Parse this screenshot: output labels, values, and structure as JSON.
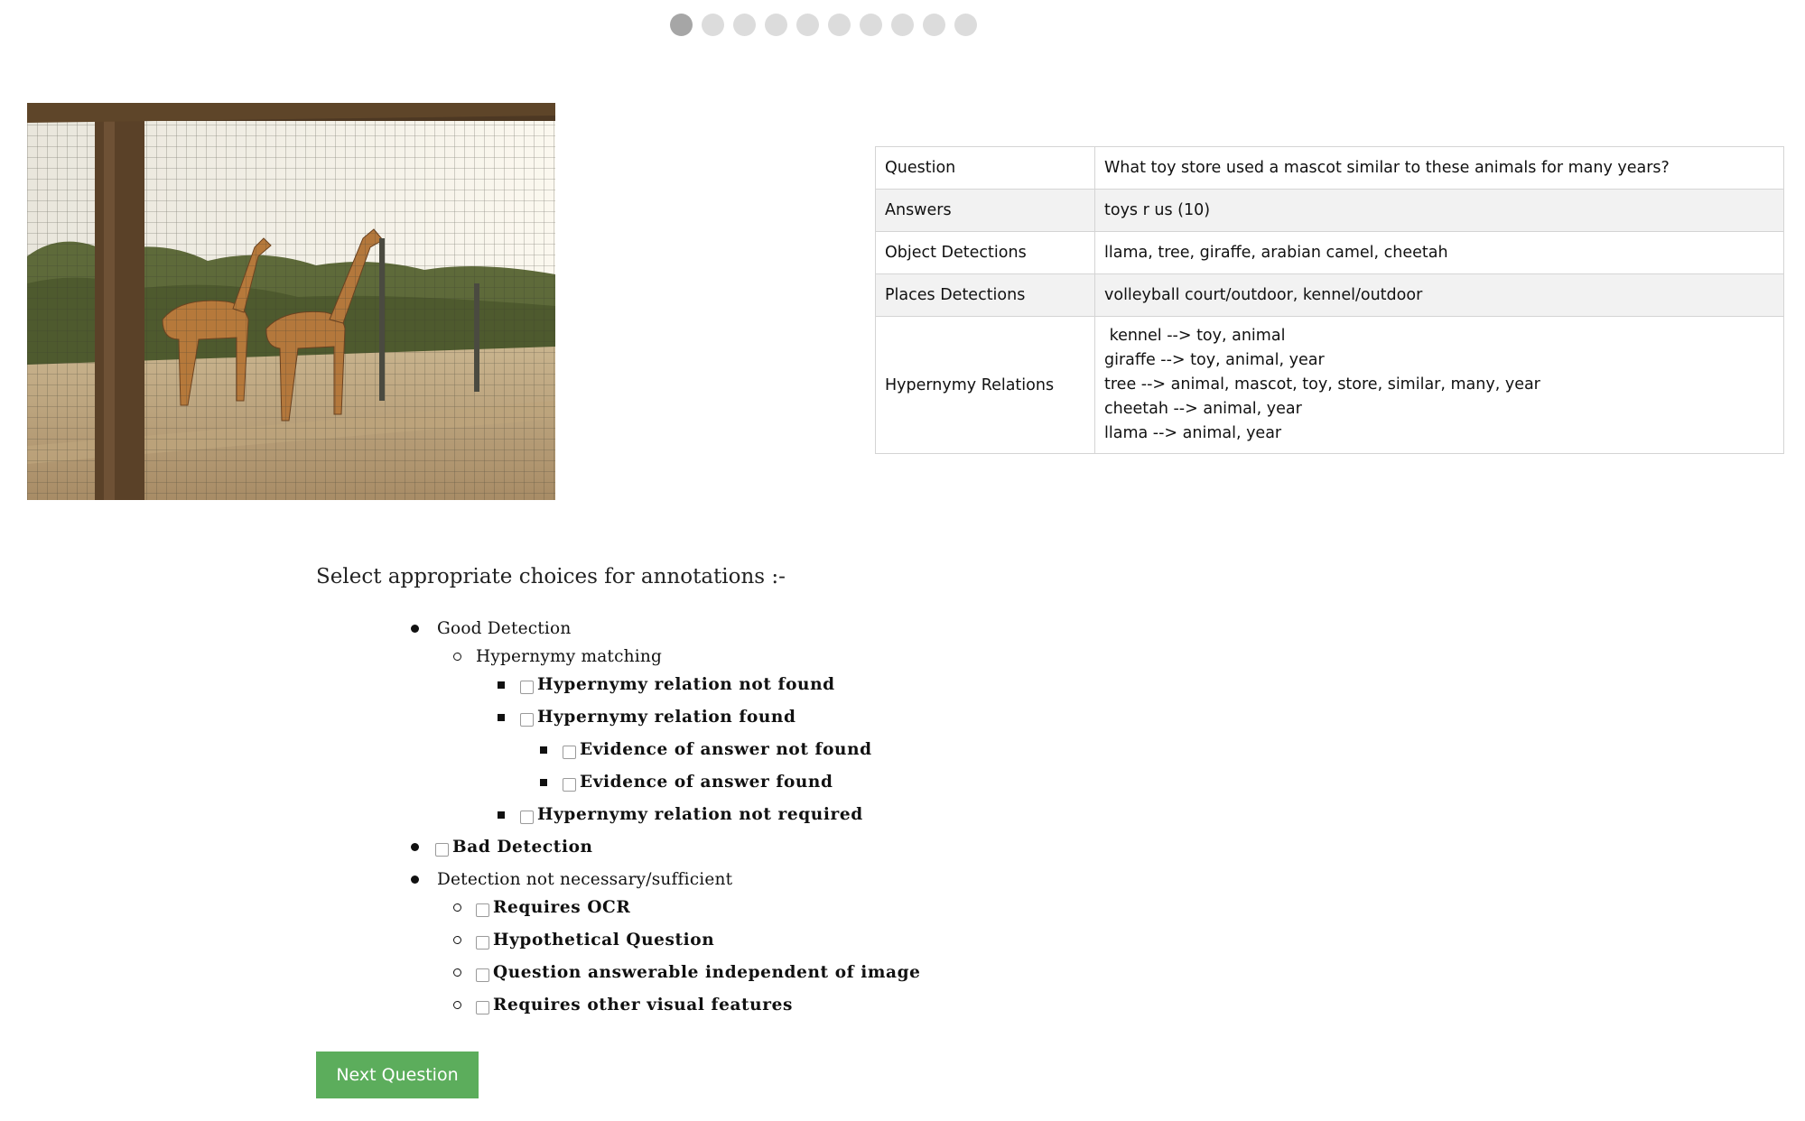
{
  "progress": {
    "total": 10,
    "current": 1
  },
  "image": {
    "alt": "giraffes"
  },
  "info_table": {
    "question_label": "Question",
    "question_value": "What toy store used a mascot similar to these animals for many years?",
    "answers_label": "Answers",
    "answers_value": "toys r us (10)",
    "objects_label": "Object Detections",
    "objects_value": "llama, tree, giraffe, arabian camel, cheetah",
    "places_label": "Places Detections",
    "places_value": "volleyball court/outdoor, kennel/outdoor",
    "hypernymy_label": "Hypernymy Relations",
    "hypernymy_lines": [
      " kennel --> toy, animal",
      "giraffe --> toy, animal, year",
      "tree --> animal, mascot, toy, store, similar, many, year",
      "cheetah --> animal, year",
      "llama --> animal, year"
    ]
  },
  "annotations": {
    "prompt": "Select appropriate choices for annotations :-",
    "good_detection": "Good Detection",
    "hypernymy_matching": "Hypernymy matching",
    "relation_not_found": "Hypernymy relation not found",
    "relation_found": "Hypernymy relation found",
    "evidence_not_found": "Evidence of answer not found",
    "evidence_found": "Evidence of answer found",
    "relation_not_required": "Hypernymy relation not required",
    "bad_detection": "Bad Detection",
    "not_necessary": "Detection not necessary/sufficient",
    "requires_ocr": "Requires OCR",
    "hypothetical": "Hypothetical Question",
    "independent": "Question answerable independent of image",
    "other_visual": "Requires other visual features"
  },
  "next_button": "Next Question",
  "colors": {
    "button": "#5cad5c",
    "dot_active": "#a6a6a6",
    "dot": "#dcdcdc"
  }
}
